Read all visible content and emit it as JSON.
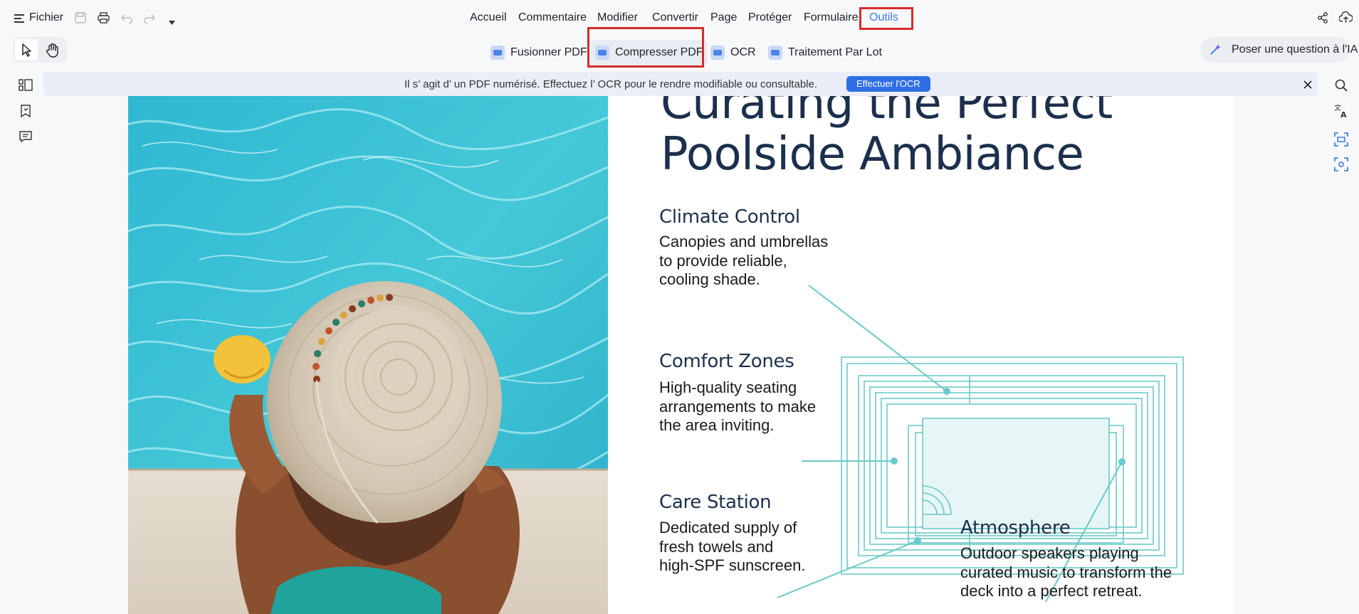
{
  "menubar": {
    "file_label": "Fichier",
    "tabs": [
      "Accueil",
      "Commentaire",
      "Modifier",
      "Convertir",
      "Page",
      "Protéger",
      "Formulaire",
      "Outils"
    ]
  },
  "toolbar": {
    "tools": [
      "Fusionner PDF",
      "Compresser PDF",
      "OCR",
      "Traitement Par Lot"
    ],
    "ask_ai": "Poser une question à l'IA"
  },
  "banner": {
    "text": "Il s’ agit d’ un PDF numérisé. Effectuez l’ OCR pour le rendre modifiable ou consultable.",
    "button": "Effectuer l'OCR"
  },
  "document": {
    "title_line1": "Curating the Perfect",
    "title_line2": "Poolside Ambiance",
    "sections": [
      {
        "heading": "Climate Control",
        "body": "Canopies and umbrellas\nto provide reliable,\ncooling shade."
      },
      {
        "heading": "Comfort Zones",
        "body": "High-quality seating\narrangements to make\nthe area inviting."
      },
      {
        "heading": "Care Station",
        "body": "Dedicated supply of\nfresh towels and\nhigh-SPF sunscreen."
      },
      {
        "heading": "Atmosphere",
        "body": "Outdoor speakers playing\ncurated music to transform the\ndeck into a perfect retreat."
      }
    ]
  },
  "colors": {
    "accent": "#3b7be8",
    "highlight": "#d62b2b",
    "pool_teal": "#6cc9c9",
    "title_navy": "#1c2f4c"
  }
}
